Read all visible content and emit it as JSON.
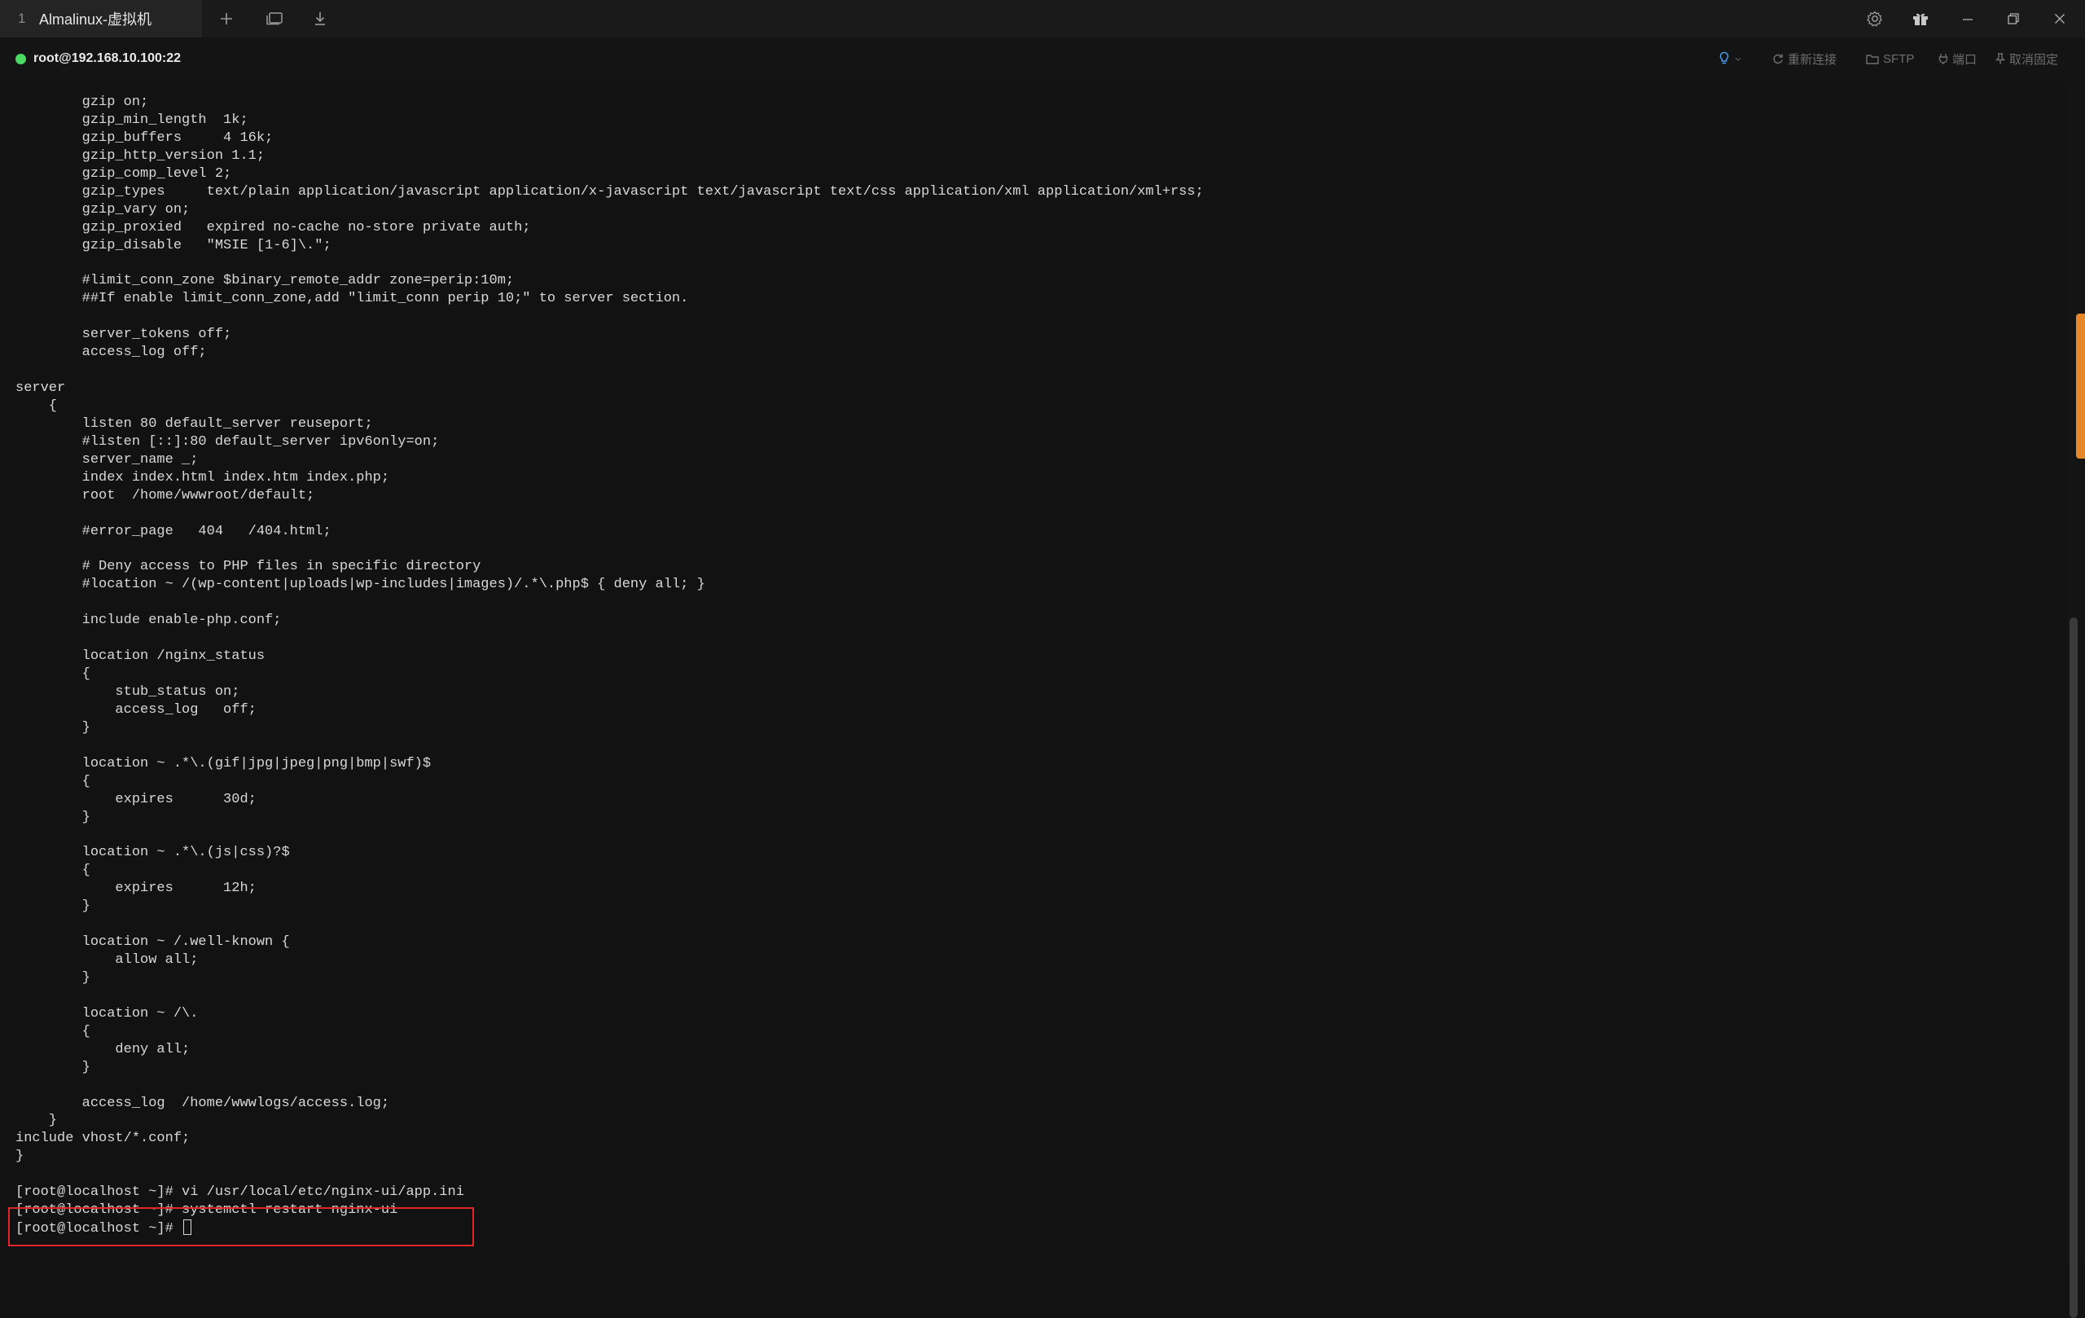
{
  "titlebar": {
    "tab_number": "1",
    "tab_title": "Almalinux-虚拟机",
    "icons": [
      "plus-icon",
      "duplicate-window-icon",
      "download-icon",
      "gear-icon",
      "gift-icon",
      "minimize-icon",
      "restore-icon",
      "close-icon"
    ]
  },
  "session": {
    "status_color": "#4cd964",
    "host": "root@192.168.10.100:22",
    "actions": {
      "reconnect": "重新连接",
      "sftp": "SFTP",
      "port": "端口",
      "unpin": "取消固定"
    }
  },
  "terminal": {
    "lines": [
      "        gzip on;",
      "        gzip_min_length  1k;",
      "        gzip_buffers     4 16k;",
      "        gzip_http_version 1.1;",
      "        gzip_comp_level 2;",
      "        gzip_types     text/plain application/javascript application/x-javascript text/javascript text/css application/xml application/xml+rss;",
      "        gzip_vary on;",
      "        gzip_proxied   expired no-cache no-store private auth;",
      "        gzip_disable   \"MSIE [1-6]\\.\";",
      "",
      "        #limit_conn_zone $binary_remote_addr zone=perip:10m;",
      "        ##If enable limit_conn_zone,add \"limit_conn perip 10;\" to server section.",
      "",
      "        server_tokens off;",
      "        access_log off;",
      "",
      "server",
      "    {",
      "        listen 80 default_server reuseport;",
      "        #listen [::]:80 default_server ipv6only=on;",
      "        server_name _;",
      "        index index.html index.htm index.php;",
      "        root  /home/wwwroot/default;",
      "",
      "        #error_page   404   /404.html;",
      "",
      "        # Deny access to PHP files in specific directory",
      "        #location ~ /(wp-content|uploads|wp-includes|images)/.*\\.php$ { deny all; }",
      "",
      "        include enable-php.conf;",
      "",
      "        location /nginx_status",
      "        {",
      "            stub_status on;",
      "            access_log   off;",
      "        }",
      "",
      "        location ~ .*\\.(gif|jpg|jpeg|png|bmp|swf)$",
      "        {",
      "            expires      30d;",
      "        }",
      "",
      "        location ~ .*\\.(js|css)?$",
      "        {",
      "            expires      12h;",
      "        }",
      "",
      "        location ~ /.well-known {",
      "            allow all;",
      "        }",
      "",
      "        location ~ /\\.",
      "        {",
      "            deny all;",
      "        }",
      "",
      "        access_log  /home/wwwlogs/access.log;",
      "    }",
      "include vhost/*.conf;",
      "}",
      "",
      "[root@localhost ~]# vi /usr/local/etc/nginx-ui/app.ini",
      "[root@localhost ~]# systemctl restart nginx-ui"
    ],
    "prompt": "[root@localhost ~]# ",
    "highlight_color": "#e0262b",
    "scroll_accent_color": "#e8862a"
  }
}
